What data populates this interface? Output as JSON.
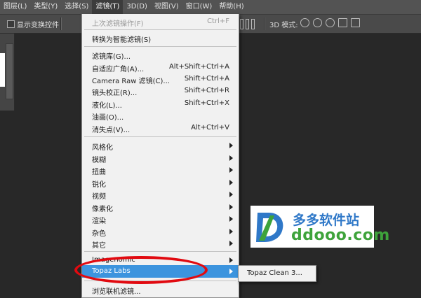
{
  "menubar": {
    "items": [
      {
        "label": "图层(L)"
      },
      {
        "label": "类型(Y)"
      },
      {
        "label": "选择(S)"
      },
      {
        "label": "滤镜(T)"
      },
      {
        "label": "3D(D)"
      },
      {
        "label": "视图(V)"
      },
      {
        "label": "窗口(W)"
      },
      {
        "label": "帮助(H)"
      }
    ]
  },
  "optbar": {
    "checkbox_label": "显示变换控件",
    "mode_label": "3D 模式:"
  },
  "filter_menu": {
    "last_filter": {
      "label": "上次滤镜操作(F)",
      "shortcut": "Ctrl+F"
    },
    "convert_smart": {
      "label": "转换为智能滤镜(S)"
    },
    "group1": [
      {
        "label": "滤镜库(G)...",
        "shortcut": ""
      },
      {
        "label": "自适应广角(A)...",
        "shortcut": "Alt+Shift+Ctrl+A"
      },
      {
        "label": "Camera Raw 滤镜(C)...",
        "shortcut": "Shift+Ctrl+A"
      },
      {
        "label": "镜头校正(R)...",
        "shortcut": "Shift+Ctrl+R"
      },
      {
        "label": "液化(L)...",
        "shortcut": "Shift+Ctrl+X"
      },
      {
        "label": "油画(O)...",
        "shortcut": ""
      },
      {
        "label": "消失点(V)...",
        "shortcut": "Alt+Ctrl+V"
      }
    ],
    "submenus": [
      {
        "label": "风格化"
      },
      {
        "label": "模糊"
      },
      {
        "label": "扭曲"
      },
      {
        "label": "锐化"
      },
      {
        "label": "视频"
      },
      {
        "label": "像素化"
      },
      {
        "label": "渲染"
      },
      {
        "label": "杂色"
      },
      {
        "label": "其它"
      }
    ],
    "plugins": [
      {
        "label": "Imagenomic"
      },
      {
        "label": "Topaz Labs"
      }
    ],
    "browse_online": {
      "label": "浏览联机滤镜..."
    }
  },
  "topaz_submenu": {
    "items": [
      {
        "label": "Topaz Clean 3..."
      }
    ]
  },
  "watermark": {
    "cn_text": "多多软件站",
    "en_text": "ddooo.com",
    "colors": {
      "blue": "#2f78c8",
      "green": "#3ea33b"
    }
  },
  "colors": {
    "highlight": "#3c94de",
    "annotation_ellipse": "#e10a10",
    "menu_bg": "#f1f1f1",
    "app_bg": "#282828"
  }
}
